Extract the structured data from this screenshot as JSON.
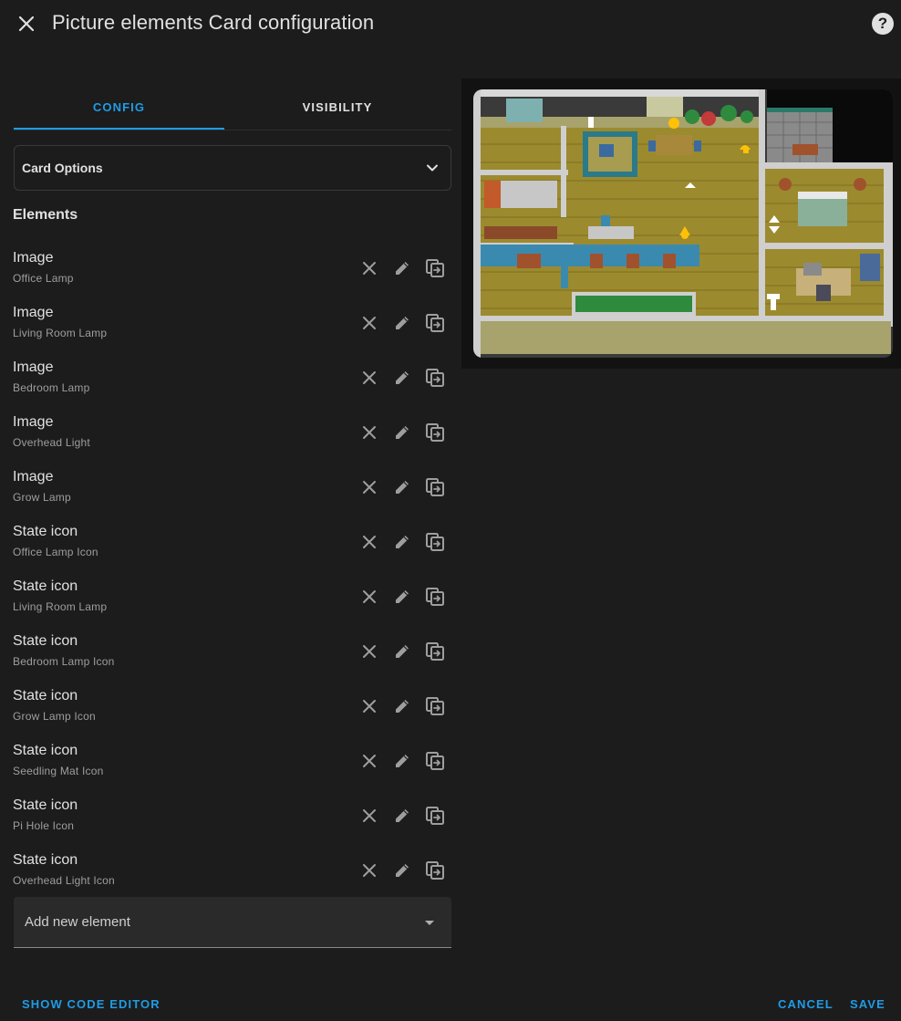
{
  "dialog": {
    "title": "Picture elements Card configuration",
    "close_icon": "close-icon",
    "help_icon": "help-circle-icon"
  },
  "tabs": [
    {
      "label": "CONFIG",
      "active": true
    },
    {
      "label": "VISIBILITY",
      "active": false
    }
  ],
  "card_options": {
    "label": "Card Options",
    "icon": "chevron-down-icon"
  },
  "elements_heading": "Elements",
  "elements": [
    {
      "type": "Image",
      "name": "Office Lamp"
    },
    {
      "type": "Image",
      "name": "Living Room Lamp"
    },
    {
      "type": "Image",
      "name": "Bedroom Lamp"
    },
    {
      "type": "Image",
      "name": "Overhead Light"
    },
    {
      "type": "Image",
      "name": "Grow Lamp"
    },
    {
      "type": "State icon",
      "name": "Office Lamp Icon"
    },
    {
      "type": "State icon",
      "name": "Living Room Lamp"
    },
    {
      "type": "State icon",
      "name": "Bedroom Lamp Icon"
    },
    {
      "type": "State icon",
      "name": "Grow Lamp Icon"
    },
    {
      "type": "State icon",
      "name": "Seedling Mat Icon"
    },
    {
      "type": "State icon",
      "name": "Pi Hole Icon"
    },
    {
      "type": "State icon",
      "name": "Overhead Light Icon"
    }
  ],
  "row_icons": {
    "remove": "close-icon",
    "edit": "pencil-icon",
    "duplicate": "content-duplicate-icon"
  },
  "add_element": {
    "label": "Add new element",
    "icon": "menu-down-icon"
  },
  "footer": {
    "show_code_editor": "SHOW CODE EDITOR",
    "cancel": "CANCEL",
    "save": "SAVE"
  },
  "colors": {
    "background": "#1c1c1c",
    "accent": "#1f9ce6",
    "text": "#e1e1e1",
    "secondary_text": "#9e9e9e",
    "floor": "#9c8a2e",
    "lamp_on": "#ffc107"
  }
}
